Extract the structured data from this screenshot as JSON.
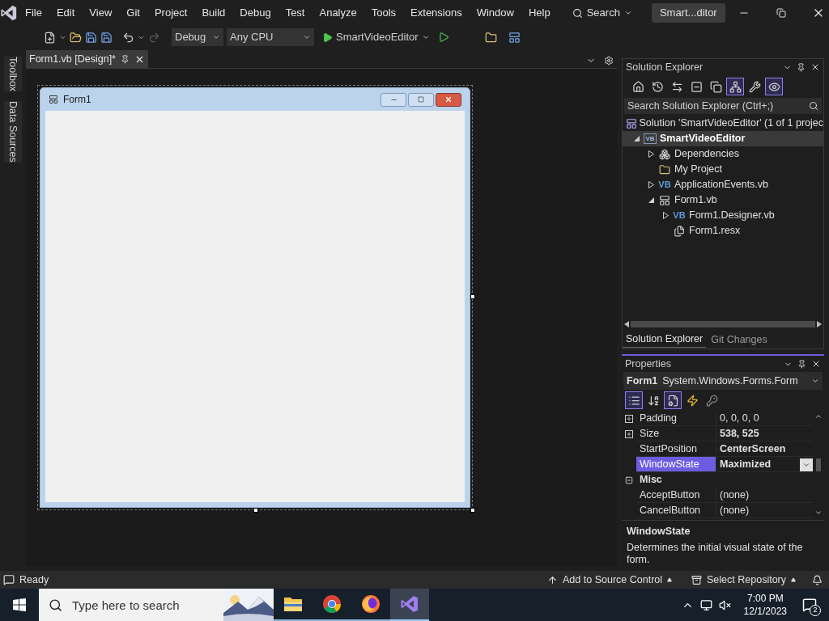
{
  "menu": [
    "File",
    "Edit",
    "View",
    "Git",
    "Project",
    "Build",
    "Debug",
    "Test",
    "Analyze",
    "Tools",
    "Extensions",
    "Window",
    "Help"
  ],
  "search_button": "Search",
  "title_badge": "Smart...ditor",
  "toolbar": {
    "configuration": "Debug",
    "platform": "Any CPU",
    "run_target": "SmartVideoEditor"
  },
  "side_tabs": [
    "Toolbox",
    "Data Sources"
  ],
  "document_tab": {
    "title": "Form1.vb [Design]*",
    "selected": true
  },
  "form": {
    "title": "Form1"
  },
  "solution_explorer": {
    "title": "Solution Explorer",
    "tools": [
      {
        "kind": "home",
        "selected": false
      },
      {
        "kind": "history",
        "selected": false
      },
      {
        "kind": "sync",
        "selected": false
      },
      {
        "kind": "collapse",
        "selected": false
      },
      {
        "kind": "copy",
        "selected": false
      },
      {
        "kind": "tree",
        "selected": true
      },
      {
        "kind": "wrench",
        "selected": false
      },
      {
        "kind": "preview",
        "selected": true
      }
    ],
    "search_placeholder": "Search Solution Explorer (Ctrl+;)",
    "tree": [
      {
        "label": "Solution 'SmartVideoEditor' (1 of 1 projec",
        "kind": "solution",
        "selected": false,
        "children": [
          {
            "label": "SmartVideoEditor",
            "kind": "project",
            "icon_text": "VB",
            "expanded": true,
            "selected": true,
            "children": [
              {
                "label": "Dependencies",
                "kind": "dependencies",
                "expanded": false,
                "selected": false
              },
              {
                "label": "My Project",
                "kind": "folder",
                "selected": false
              },
              {
                "label": "ApplicationEvents.vb",
                "kind": "code",
                "icon_text": "VB",
                "expanded": false,
                "selected": false
              },
              {
                "label": "Form1.vb",
                "kind": "form",
                "expanded": true,
                "selected": false,
                "children": [
                  {
                    "label": "Form1.Designer.vb",
                    "kind": "code",
                    "icon_text": "VB",
                    "expanded": false,
                    "selected": false
                  },
                  {
                    "label": "Form1.resx",
                    "kind": "resx",
                    "selected": false
                  }
                ]
              }
            ]
          }
        ]
      }
    ],
    "tabs": [
      {
        "label": "Solution Explorer",
        "selected": true
      },
      {
        "label": "Git Changes",
        "selected": false
      }
    ]
  },
  "properties": {
    "title": "Properties",
    "object": "Form1",
    "type": "System.Windows.Forms.Form",
    "tools": [
      {
        "kind": "categorized",
        "selected": true
      },
      {
        "kind": "alphabetical",
        "selected": false
      },
      {
        "kind": "properties",
        "selected": true
      },
      {
        "kind": "events",
        "selected": false
      },
      {
        "kind": "pages",
        "selected": false
      }
    ],
    "rows": [
      {
        "kind": "property",
        "name": "Padding",
        "value": "0, 0, 0, 0",
        "expanded": false,
        "modified": false,
        "selected": false
      },
      {
        "kind": "property",
        "name": "Size",
        "value": "538, 525",
        "expanded": false,
        "modified": true,
        "selected": false
      },
      {
        "kind": "property",
        "name": "StartPosition",
        "value": "CenterScreen",
        "modified": true,
        "selected": false
      },
      {
        "kind": "property",
        "name": "WindowState",
        "value": "Maximized",
        "modified": true,
        "selected": true
      },
      {
        "kind": "category",
        "name": "Misc",
        "expanded": true
      },
      {
        "kind": "property",
        "name": "AcceptButton",
        "value": "(none)",
        "modified": false,
        "selected": false
      },
      {
        "kind": "property",
        "name": "CancelButton",
        "value": "(none)",
        "modified": false,
        "selected": false
      }
    ],
    "description_title": "WindowState",
    "description": "Determines the initial visual state of the form."
  },
  "status_bar": {
    "state": "Ready",
    "source_control": "Add to Source Control",
    "repository": "Select Repository"
  },
  "taskbar": {
    "search_placeholder": "Type here to search",
    "apps": [
      {
        "kind": "files",
        "selected": false
      },
      {
        "kind": "chrome",
        "selected": false
      },
      {
        "kind": "firefox",
        "selected": false
      },
      {
        "kind": "vs",
        "selected": true
      }
    ],
    "time": "7:00 PM",
    "date": "12/1/2023",
    "notifications": "2"
  }
}
